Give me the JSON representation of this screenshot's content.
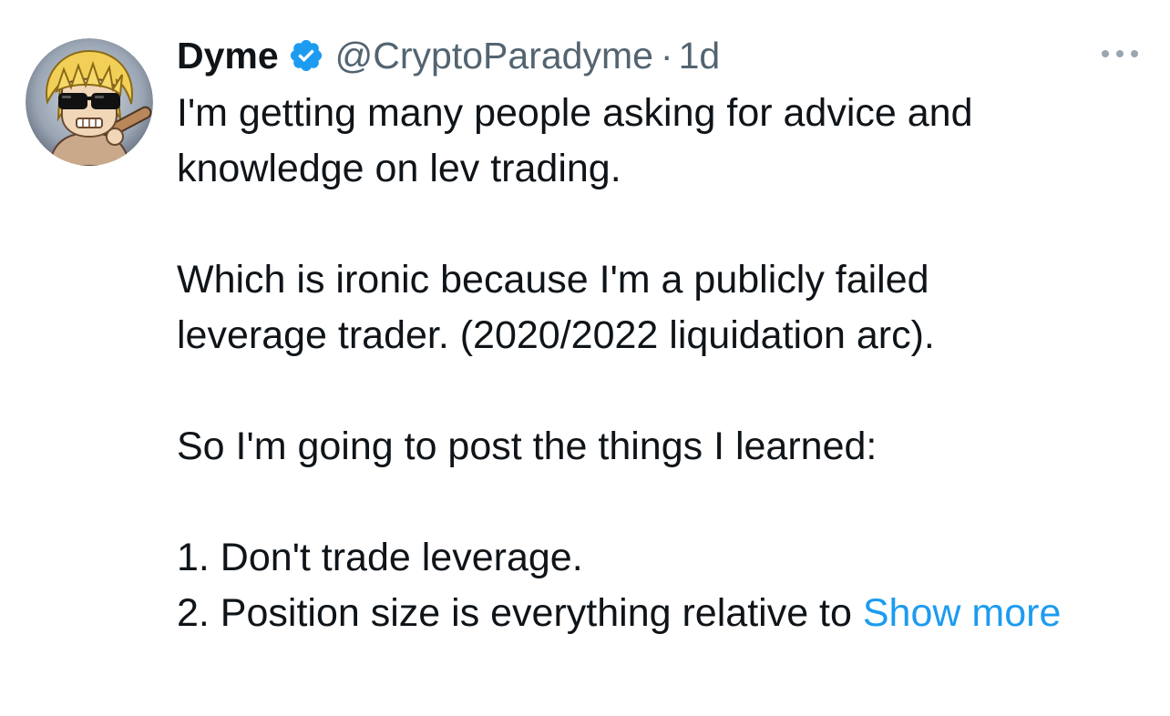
{
  "tweet": {
    "author": {
      "display_name": "Dyme",
      "handle": "@CryptoParadyme",
      "verified_icon": "verified-badge-icon",
      "avatar_icon": "cartoon-avatar-sunglasses"
    },
    "separator": "·",
    "timestamp": "1d",
    "more_icon": "more-dots-icon",
    "body_lines": [
      "I'm getting many people asking for advice and",
      "knowledge on lev trading.",
      "Which is ironic because I'm a publicly failed",
      "leverage trader. (2020/2022 liquidation arc).",
      "So I'm going to post the things I learned:",
      "1. Don't trade leverage.",
      "2. Position size is everything relative to"
    ],
    "show_more_label": "Show more",
    "colors": {
      "text": "#0f1419",
      "secondary": "#536471",
      "link": "#1d9bf0",
      "verified": "#1d9bf0"
    }
  }
}
